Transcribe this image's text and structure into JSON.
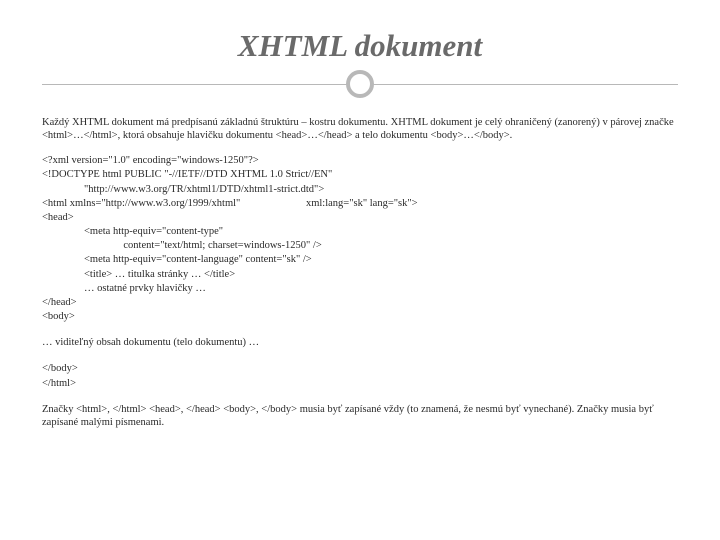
{
  "title": "XHTML dokument",
  "intro": "Každý XHTML dokument má predpísanú základnú štruktúru – kostru dokumentu. XHTML dokument je celý ohraničený (zanorený) v párovej značke <html>…</html>, ktorá obsahuje hlavičku dokumentu <head>…</head> a telo dokumentu <body>…</body>.",
  "code": "<?xml version=\"1.0\" encoding=\"windows-1250\"?>\n<!DOCTYPE html PUBLIC \"-//IETF//DTD XHTML 1.0 Strict//EN\"\n                \"http://www.w3.org/TR/xhtml1/DTD/xhtml1-strict.dtd\">\n<html xmlns=\"http://www.w3.org/1999/xhtml\"                         xml:lang=\"sk\" lang=\"sk\">\n<head>\n                <meta http-equiv=\"content-type\"\n                               content=\"text/html; charset=windows-1250\" />\n                <meta http-equiv=\"content-language\" content=\"sk\" />\n                <title> … titulka stránky … </title>\n                … ostatné prvky hlavičky …\n</head>\n<body>",
  "mid": "… viditeľný obsah dokumentu (telo dokumentu) …",
  "closing": "</body>\n</html>",
  "footer": "Značky <html>, </html> <head>, </head> <body>, </body> musia byť zapísané vždy (to znamená, že nesmú byť vynechané). Značky musia byť zapísané malými písmenami."
}
